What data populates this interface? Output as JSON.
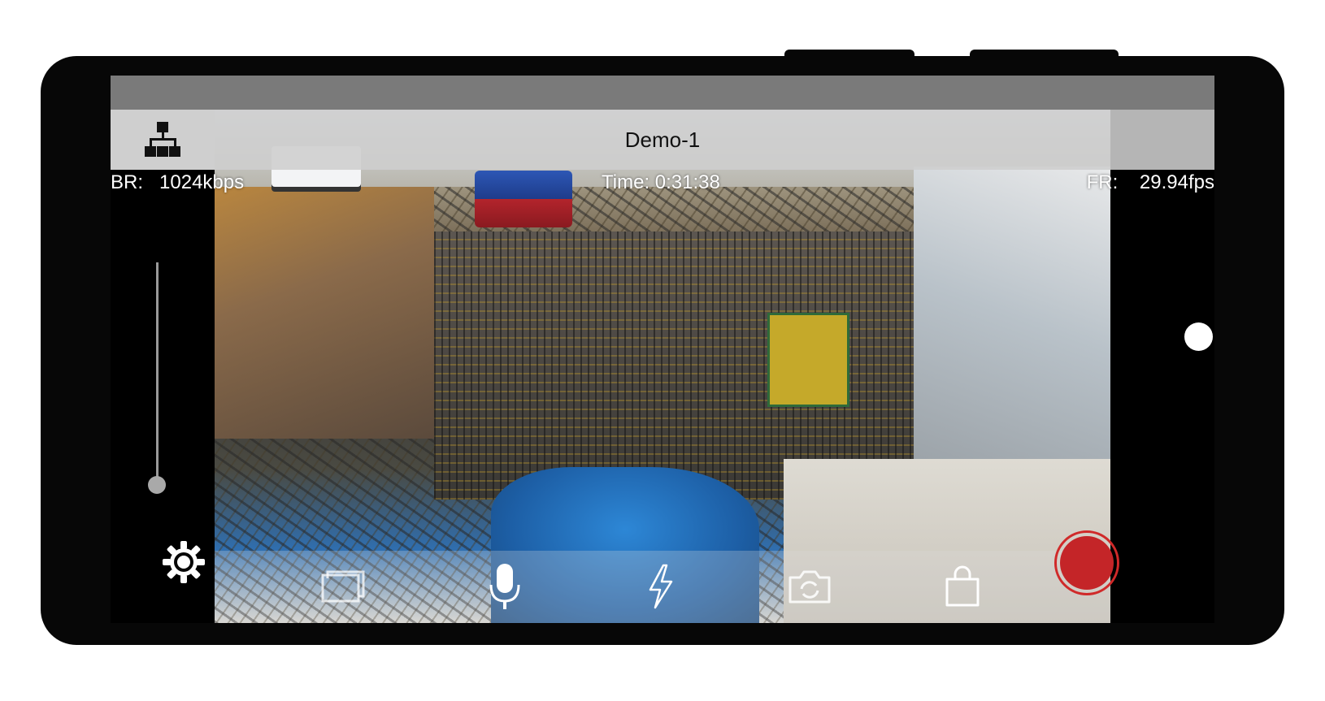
{
  "stream": {
    "name": "Demo-1",
    "bitrate_label": "BR:",
    "bitrate_value": "1024kbps",
    "time_label": "Time:",
    "time_value": "0:31:38",
    "framerate_label": "FR:",
    "framerate_value": "29.94fps"
  },
  "slider": {
    "level": 0.0
  },
  "icons": {
    "network": "network-icon",
    "settings": "gear-icon",
    "image": "image-icon",
    "microphone": "microphone-icon",
    "flash": "flash-icon",
    "camera": "camera-switch-icon",
    "bag": "shopping-bag-icon",
    "record": "record-icon"
  },
  "colors": {
    "record": "#c42528",
    "device": "#070707",
    "titlebar": "#cecece"
  }
}
